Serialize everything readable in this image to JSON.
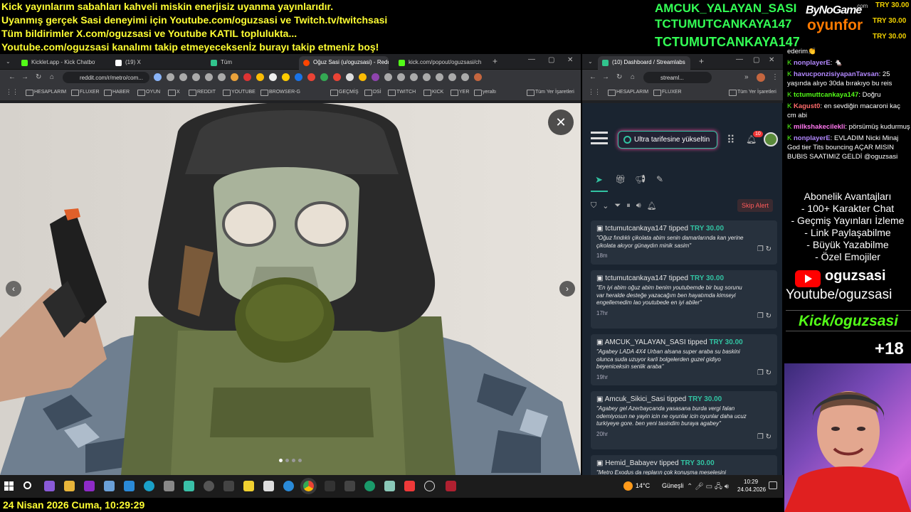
{
  "overlay": {
    "lines": [
      "Kick yayınlarım sabahları kahveli miskin enerjisiz uyanma yayınlarıdır.",
      "Uyanmış gerçek Sasi deneyimi için Youtube.com/oguzsasi ve Twitch.tv/twitchsasi",
      "Tüm bildirimler X.com/oguzsasi ve Youtube KATIL toplulukta...",
      "Youtube.com/oguzsasi kanalımı takip etmeyeceksenİz burayı takip etmeniz boş!"
    ],
    "donors": [
      "AMCUK_YALAYAN_SASI",
      "TCTUMUTCANKAYA147",
      "TCTUMUTCANKAYA147"
    ],
    "sponsor_top": "ByNoGame",
    "sponsor_com": ".com",
    "sponsor_bottom": "oyunfor",
    "try_amounts": [
      "TRY 30.00",
      "TRY 30.00",
      "TRY 30.00"
    ],
    "footer_datetime": "24 Nisan 2026 Cuma, 10:29:29"
  },
  "left_browser": {
    "tabs": [
      {
        "label": "Kicklet.app - Kick Chatbot and",
        "color": "#53fc18"
      },
      {
        "label": "(19) X",
        "color": "#ffffff"
      },
      {
        "label": "Tüm",
        "color": "#31c48d"
      },
      {
        "label": "Oğuz Sasi (u/oguzsasi) - Reddi",
        "color": "#ff4500"
      },
      {
        "label": "kick.com/popout/oguzsasi/ch",
        "color": "#53fc18"
      }
    ],
    "url": "reddit.com/r/metro/com...",
    "bookmarks": [
      "HESAPLARIM",
      "FLUXER",
      "HABER",
      "OYUN",
      "X",
      "REDDIT",
      "YOUTUBE",
      "BROWSER-G",
      "GEÇMİŞ",
      "DSİ",
      "TWITCH",
      "KICK",
      "YER",
      "yeraltı",
      "Tüm Yer İşaretleri"
    ]
  },
  "right_browser": {
    "tab": "(10) Dashboard / Streamlabs",
    "url": "streaml...",
    "bookmarks": [
      "HESAPLARIM",
      "FLUXER",
      "Tüm Yer İşaretleri"
    ],
    "upgrade_label": "Ultra tarifesine yükseltin",
    "notif_count": "10",
    "skip_alert": "Skip Alert",
    "feed": [
      {
        "user": "tctumutcankaya147",
        "verb": "tipped",
        "amount": "TRY 30.00",
        "msg": "\"Oğuz fındıklı çikolata abim senin damarlarında kan yerine çikolata akıyor günaydın minik sasim\"",
        "time": "18m"
      },
      {
        "user": "tctumutcankaya147",
        "verb": "tipped",
        "amount": "TRY 30.00",
        "msg": "\"En iyi abim oğuz abim benim youtubemde bir bug sorunu var heralde desteğe yazacağım ben hayatımda kimseyi engellemedim lao youtubede en iyi abiler\"",
        "time": "17hr"
      },
      {
        "user": "AMCUK_YALAYAN_SASI",
        "verb": "tipped",
        "amount": "TRY 30.00",
        "msg": "\"Agabey LADA 4X4 Urban alsana super araba su baskini olunca suda uzuyor karli bolgelerden guzel gidiyo beyeniceksin senlik araba\"",
        "time": "19hr"
      },
      {
        "user": "Amcuk_Sikici_Sasi",
        "verb": "tipped",
        "amount": "TRY 30.00",
        "msg": "\"Agabey gel Azerbaycanda yasasana burda vergi falan odemiyosun ne yayin icin ne oyunlar icin oyunlar daha ucuz turkiyeye gore. ben yeni tasindim buraya agabey\"",
        "time": "20hr"
      },
      {
        "user": "Hemid_Babayev",
        "verb": "tipped",
        "amount": "TRY 30.00",
        "msg": "\"Metro Exodus da repların çok konuşma meselesini",
        "time": ""
      }
    ]
  },
  "chat": {
    "rows": [
      {
        "user": "",
        "color": "#ffffff",
        "text": "ederim👏"
      },
      {
        "user": "nonplayerE",
        "color": "#b388ff",
        "text": ": 🐁"
      },
      {
        "user": "havucponzisiyapanTavsan",
        "color": "#b388ff",
        "text": ": 25 yaşında alıyo 30da bırakıyo bu reis"
      },
      {
        "user": "tctumuttcankaya147",
        "color": "#53fc18",
        "text": ": Doğru"
      },
      {
        "user": "Kagust0",
        "color": "#ff6b6b",
        "text": ": en sevdiğin macaroni kaç cm abi"
      },
      {
        "user": "milkshakecilekli",
        "color": "#ff77ee",
        "text": ": pörsümüş kudurmuş"
      },
      {
        "user": "nonplayerE",
        "color": "#b388ff",
        "text": ": EVLADIM Nicki Minaj God tier Tits bouncing AÇAR MISIN BUBIS SAATIMIZ GELDİ @oguzsasi"
      }
    ],
    "benefits_title": "Abonelik Avantajları",
    "benefits": [
      "- 100+ Karakter Chat",
      "- Geçmiş Yayınları İzleme",
      "- Link Paylaşabilme",
      "- Büyük Yazabilme",
      "- Özel Emojiler"
    ],
    "yt_name": "oguzsasi",
    "yt_link": "Youtube/oguzsasi",
    "kick_link": "Kick/oguzsasi",
    "age": "+18"
  },
  "taskbar": {
    "weather": "14°C",
    "weather_label": "Güneşli",
    "time": "10:29",
    "date": "24.04.2026"
  }
}
